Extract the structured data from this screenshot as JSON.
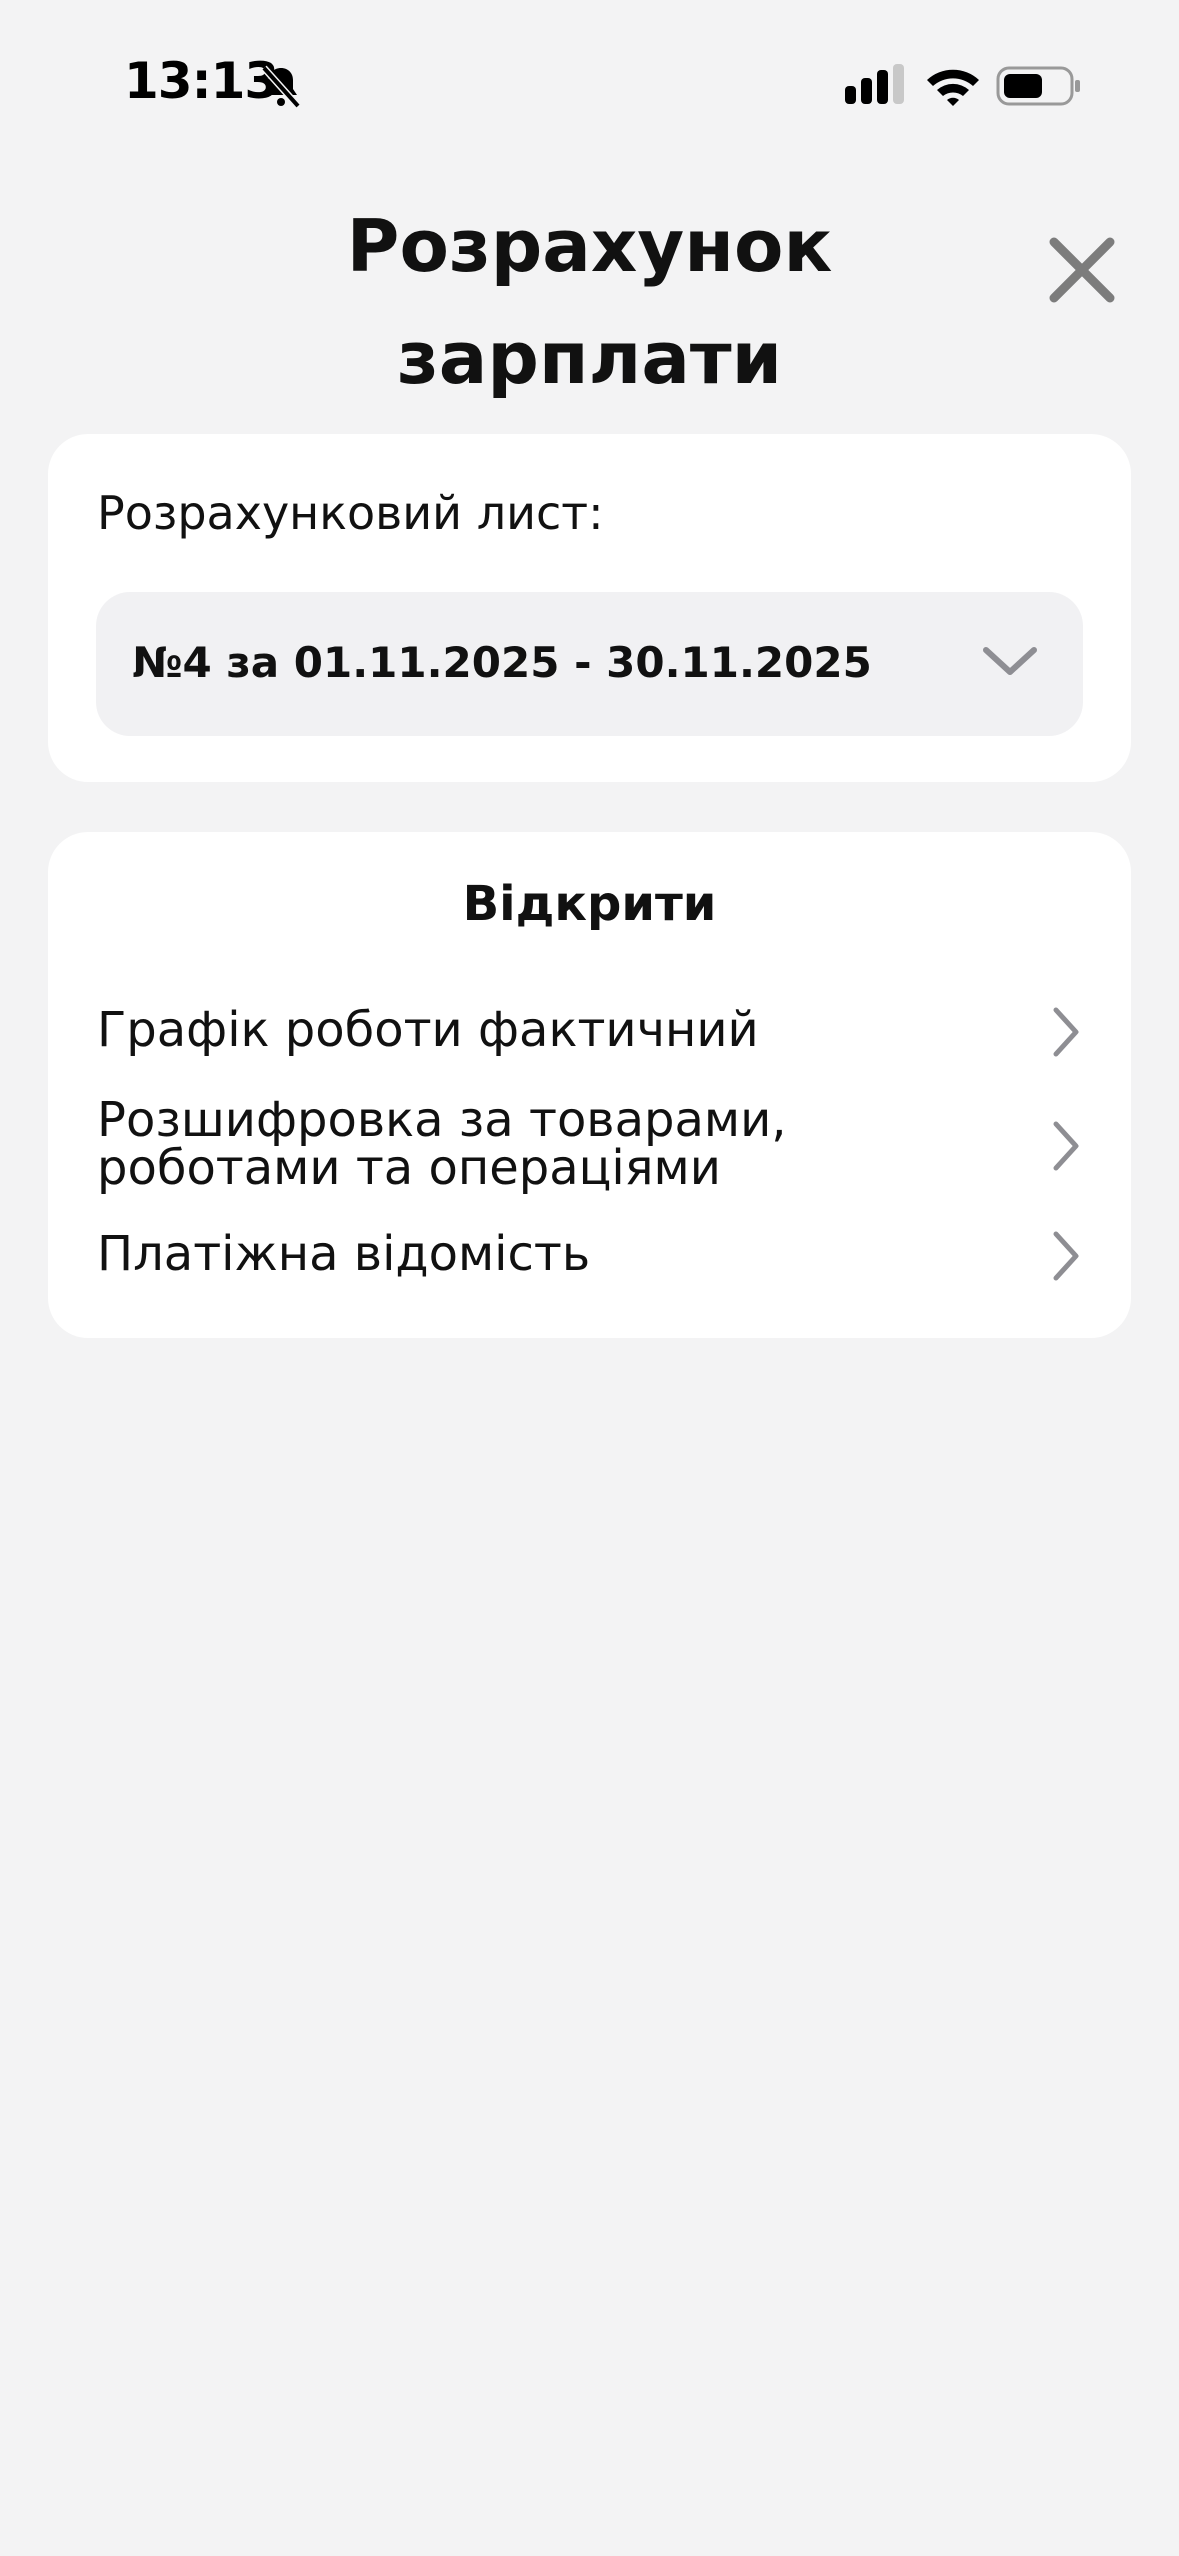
{
  "status_bar": {
    "time": "13:13",
    "icons": [
      "bell-slash-icon",
      "cellular-signal-icon",
      "wifi-icon",
      "battery-icon"
    ]
  },
  "header": {
    "title": "Розрахунок\nзарплати",
    "close_icon": "close-icon"
  },
  "payslip": {
    "label": "Розрахунковий лист:",
    "selected_value": "№4 за 01.11.2025 - 30.11.2025",
    "dropdown_icon": "chevron-down-icon"
  },
  "open_section": {
    "heading": "Відкрити",
    "items": [
      {
        "label": "Графік роботи фактичний",
        "icon": "chevron-right-icon"
      },
      {
        "label": "Розшифровка за товарами,\nроботами та операціями",
        "icon": "chevron-right-icon"
      },
      {
        "label": "Платіжна відомість",
        "icon": "chevron-right-icon"
      }
    ]
  },
  "colors": {
    "background": "#f3f3f4",
    "card": "#ffffff",
    "select_background": "#f1f1f3",
    "icon_gray": "#8e8e93",
    "text": "#111111"
  }
}
